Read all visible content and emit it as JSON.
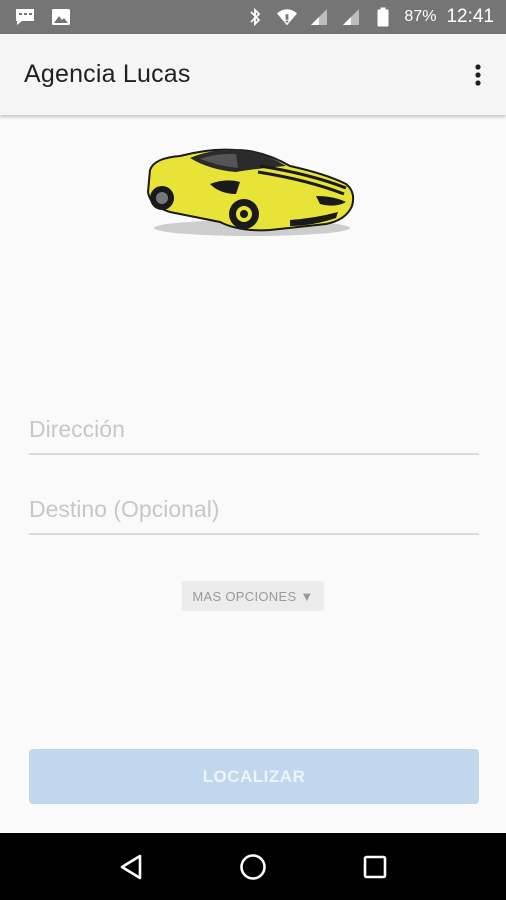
{
  "status_bar": {
    "battery": "87%",
    "time": "12:41",
    "icons": [
      "message-icon",
      "image-icon",
      "bluetooth-icon",
      "wifi-icon",
      "signal-icon",
      "signal-icon",
      "battery-icon"
    ]
  },
  "app_bar": {
    "title": "Agencia Lucas",
    "overflow_icon": "more-vert-icon"
  },
  "form": {
    "address_placeholder": "Dirección",
    "address_value": "",
    "destination_placeholder": "Destino (Opcional)",
    "destination_value": "",
    "more_options_label": "MAS OPCIONES",
    "more_options_arrow": "▼",
    "locate_label": "LOCALIZAR"
  },
  "nav_bar": {
    "buttons": [
      "back-icon",
      "home-icon",
      "recents-icon"
    ]
  },
  "colors": {
    "status_bar": "#757575",
    "app_bar": "#f5f5f5",
    "background": "#fafafa",
    "primary_disabled": "#c0d7ee",
    "car_yellow": "#e8e337"
  }
}
